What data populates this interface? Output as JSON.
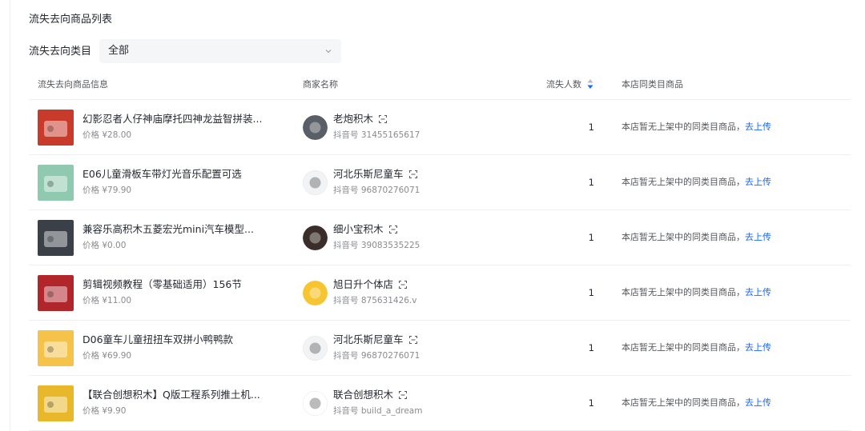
{
  "section_title": "流失去向商品列表",
  "filter": {
    "label": "流失去向类目",
    "selected": "全部",
    "icon": "chevron-down-icon"
  },
  "table": {
    "columns": [
      "流失去向商品信息",
      "商家名称",
      "流失人数",
      "本店同类目商品"
    ],
    "sort_icon": "sort-icon",
    "rows": [
      {
        "product": "幻影忍者人仔神庙摩托四神龙益智拼装...",
        "price": "价格 ¥28.00",
        "shop": "老炮积木",
        "shop_id": "抖音号 31455165617",
        "lost": "1",
        "same_text": "本店暂无上架中的同类目商品，",
        "same_link": "去上传",
        "thumb_color": "#c83a2a",
        "avatar_color": "#5a5e66"
      },
      {
        "product": "E06儿童滑板车带灯光音乐配置可选",
        "price": "价格 ¥79.90",
        "shop": "河北乐斯尼童车",
        "shop_id": "抖音号 96870276071",
        "lost": "1",
        "same_text": "本店暂无上架中的同类目商品，",
        "same_link": "去上传",
        "thumb_color": "#8fc9b0",
        "avatar_color": "#f2f3f5"
      },
      {
        "product": "兼容乐高积木五菱宏光mini汽车模型...",
        "price": "价格 ¥0.00",
        "shop": "细小宝积木",
        "shop_id": "抖音号 39083535225",
        "lost": "1",
        "same_text": "本店暂无上架中的同类目商品，",
        "same_link": "去上传",
        "thumb_color": "#3a3f48",
        "avatar_color": "#3b2e2a"
      },
      {
        "product": "剪辑视频教程（零基础适用）156节",
        "price": "价格 ¥11.00",
        "shop": "旭日升个体店",
        "shop_id": "抖音号 875631426.v",
        "lost": "1",
        "same_text": "本店暂无上架中的同类目商品，",
        "same_link": "去上传",
        "thumb_color": "#b0262a",
        "avatar_color": "#f7c531"
      },
      {
        "product": "D06童车儿童扭扭车双拼小鸭鸭款",
        "price": "价格 ¥69.90",
        "shop": "河北乐斯尼童车",
        "shop_id": "抖音号 96870276071",
        "lost": "1",
        "same_text": "本店暂无上架中的同类目商品，",
        "same_link": "去上传",
        "thumb_color": "#f5c24a",
        "avatar_color": "#f2f3f5"
      },
      {
        "product": "【联合创想积木】Q版工程系列推土机...",
        "price": "价格 ¥9.90",
        "shop": "联合创想积木",
        "shop_id": "抖音号 build_a_dream",
        "lost": "1",
        "same_text": "本店暂无上架中的同类目商品，",
        "same_link": "去上传",
        "thumb_color": "#e8b82a",
        "avatar_color": "#ffffff"
      }
    ]
  },
  "colors": {
    "link": "#1966ff",
    "text": "#252931",
    "muted": "#898b8f",
    "divider": "#eeeff2",
    "select_bg": "#f5f6f7"
  }
}
